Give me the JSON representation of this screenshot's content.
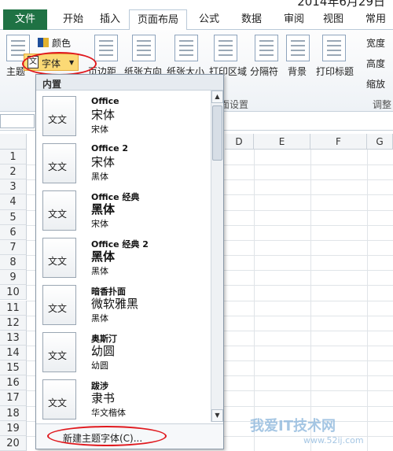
{
  "title_fragment": "2014年6月29日",
  "tabs": {
    "file": "文件",
    "items": [
      "开始",
      "插入",
      "页面布局",
      "公式",
      "数据",
      "审阅",
      "视图",
      "常用"
    ],
    "active": "页面布局"
  },
  "ribbon": {
    "theme_label": "主题",
    "colors_label": "颜色",
    "fonts_label": "字体",
    "margins_label": "页边距",
    "orientation_label": "纸张方向",
    "size_label": "纸张大小",
    "print_area_label": "打印区域",
    "breaks_label": "分隔符",
    "background_label": "背景",
    "print_titles_label": "打印标题",
    "width_label": "宽度",
    "height_label": "高度",
    "scale_label": "缩放",
    "group_page_setup": "页面设置",
    "group_scale": "调整"
  },
  "sheet": {
    "columns": [
      "D",
      "E",
      "F",
      "G"
    ],
    "rows": [
      "1",
      "2",
      "3",
      "4",
      "5",
      "6",
      "7",
      "8",
      "9",
      "10",
      "11",
      "12",
      "13",
      "14",
      "15",
      "16",
      "17",
      "18",
      "19",
      "20"
    ]
  },
  "dropdown": {
    "header": "内置",
    "thumb_text": "文文",
    "items": [
      {
        "name": "Office",
        "heading": "宋体",
        "body": "宋体"
      },
      {
        "name": "Office 2",
        "heading": "宋体",
        "body": "黑体"
      },
      {
        "name": "Office 经典",
        "heading": "黑体",
        "body": "宋体"
      },
      {
        "name": "Office 经典 2",
        "heading": "黑体",
        "body": "黑体"
      },
      {
        "name": "暗香扑面",
        "heading": "微软雅黑",
        "body": "黑体"
      },
      {
        "name": "奥斯汀",
        "heading": "幼圆",
        "body": "幼圆"
      },
      {
        "name": "跋涉",
        "heading": "隶书",
        "body": "华文楷体"
      }
    ],
    "footer_link": "新建主题字体(C)..."
  },
  "watermark": {
    "text": "我爱IT技术网",
    "url": "www.52ij.com"
  }
}
